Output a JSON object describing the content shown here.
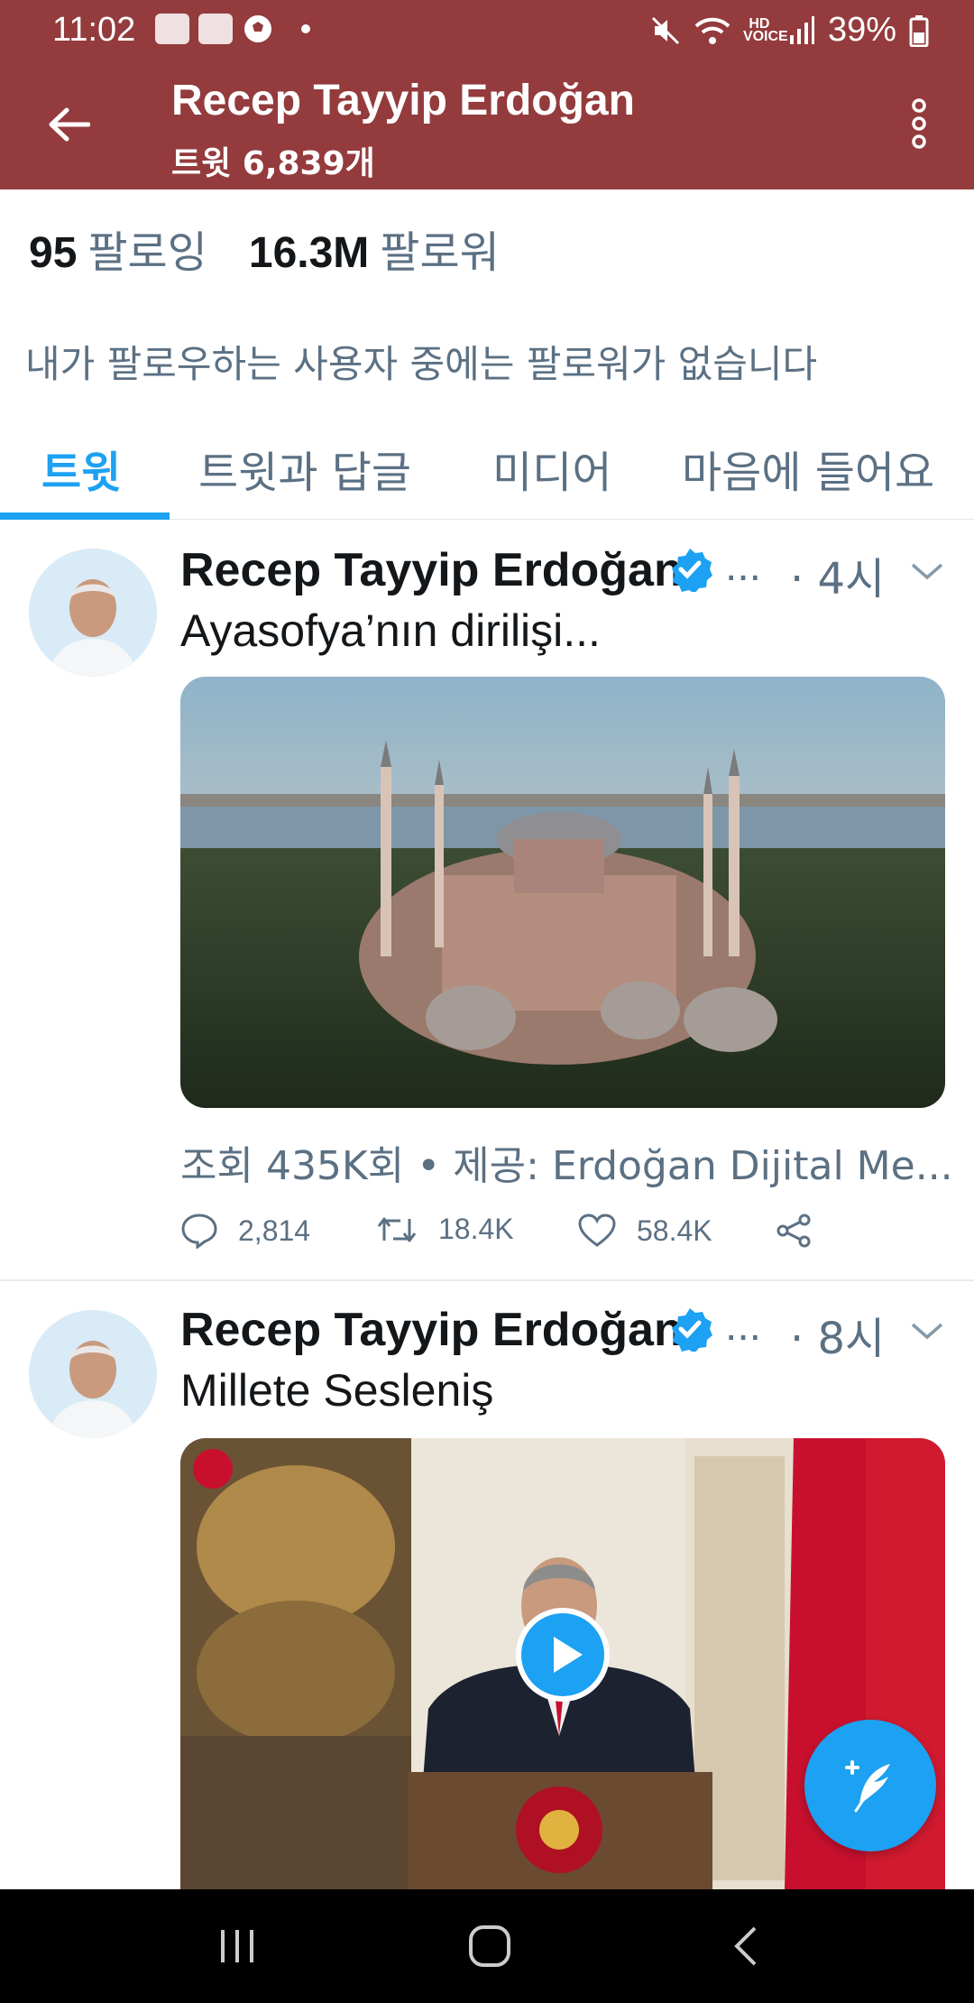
{
  "status_bar": {
    "time": "11:02",
    "battery": "39%",
    "network_label": "HD VOICE"
  },
  "header": {
    "title": "Recep Tayyip Erdoğan",
    "subtitle": "트윗 6,839개",
    "bg_color": "#943b3d"
  },
  "profile": {
    "following_count": "95",
    "following_label": "팔로잉",
    "followers_count": "16.3M",
    "followers_label": "팔로워",
    "mutual_note": "내가 팔로우하는 사용자 중에는 팔로워가 없습니다"
  },
  "tabs": [
    {
      "label": "트윗",
      "active": true
    },
    {
      "label": "트윗과 답글",
      "active": false
    },
    {
      "label": "미디어",
      "active": false
    },
    {
      "label": "마음에 들어요",
      "active": false
    }
  ],
  "tweets": [
    {
      "author": "Recep Tayyip Erdoğan",
      "ellipsis": "...",
      "time": "· 4시",
      "text": "Ayasofya’nın dirilişi...",
      "views": "조회 435K회 • 제공: Erdoğan Dijital Me...",
      "replies": "2,814",
      "retweets": "18.4K",
      "likes": "58.4K"
    },
    {
      "author": "Recep Tayyip Erdoğan",
      "ellipsis": "...",
      "time": "· 8시",
      "text": "Millete Sesleniş"
    }
  ],
  "colors": {
    "accent": "#1da1f2",
    "secondary_text": "#5b7083"
  }
}
